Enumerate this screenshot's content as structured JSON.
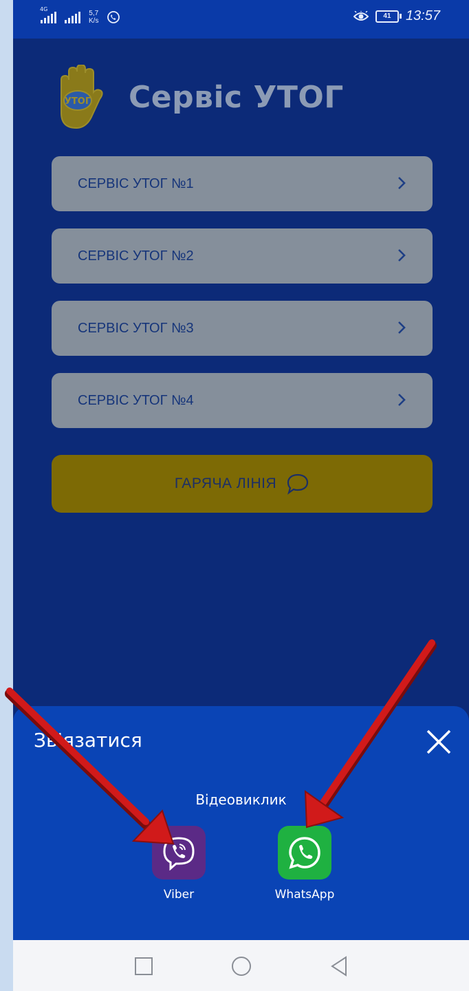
{
  "status_bar": {
    "network_1": "4G",
    "speed_value": "5,7",
    "speed_unit": "K/s",
    "battery": "41",
    "time": "13:57"
  },
  "app": {
    "title": "Сервіс УТОГ",
    "logo_text": "УТОГ",
    "services": [
      {
        "label": "СЕРВІС УТОГ №1"
      },
      {
        "label": "СЕРВІС УТОГ №2"
      },
      {
        "label": "СЕРВІС УТОГ №3"
      },
      {
        "label": "СЕРВІС УТОГ №4"
      }
    ],
    "hotline_label": "ГАРЯЧА ЛІНІЯ"
  },
  "sheet": {
    "title": "Зв'язатися",
    "subtitle": "Відеовиклик",
    "apps": [
      {
        "name": "Viber",
        "color": "#5b2a86"
      },
      {
        "name": "WhatsApp",
        "color": "#1fb141"
      }
    ]
  },
  "colors": {
    "background": "#0c2a78",
    "sheet": "#0a44b5",
    "service_button": "#858f9b",
    "hotline_button": "#7d6a05",
    "arrow": "#d11a1a"
  }
}
